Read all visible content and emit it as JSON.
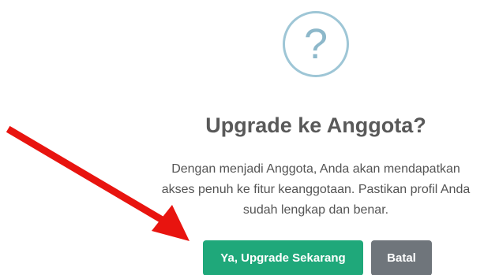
{
  "dialog": {
    "icon": "question-mark-icon",
    "icon_glyph": "?",
    "title": "Upgrade ke Anggota?",
    "message_lines": [
      "Dengan menjadi Anggota, Anda akan mendapatkan",
      "akses penuh ke fitur keanggotaan. Pastikan profil Anda",
      "sudah lengkap dan benar."
    ],
    "confirm_label": "Ya, Upgrade Sekarang",
    "cancel_label": "Batal"
  },
  "colors": {
    "confirm": "#1fa87a",
    "cancel": "#6f757b",
    "icon": "#9ec6d6",
    "annotation_arrow": "#e8140f"
  }
}
